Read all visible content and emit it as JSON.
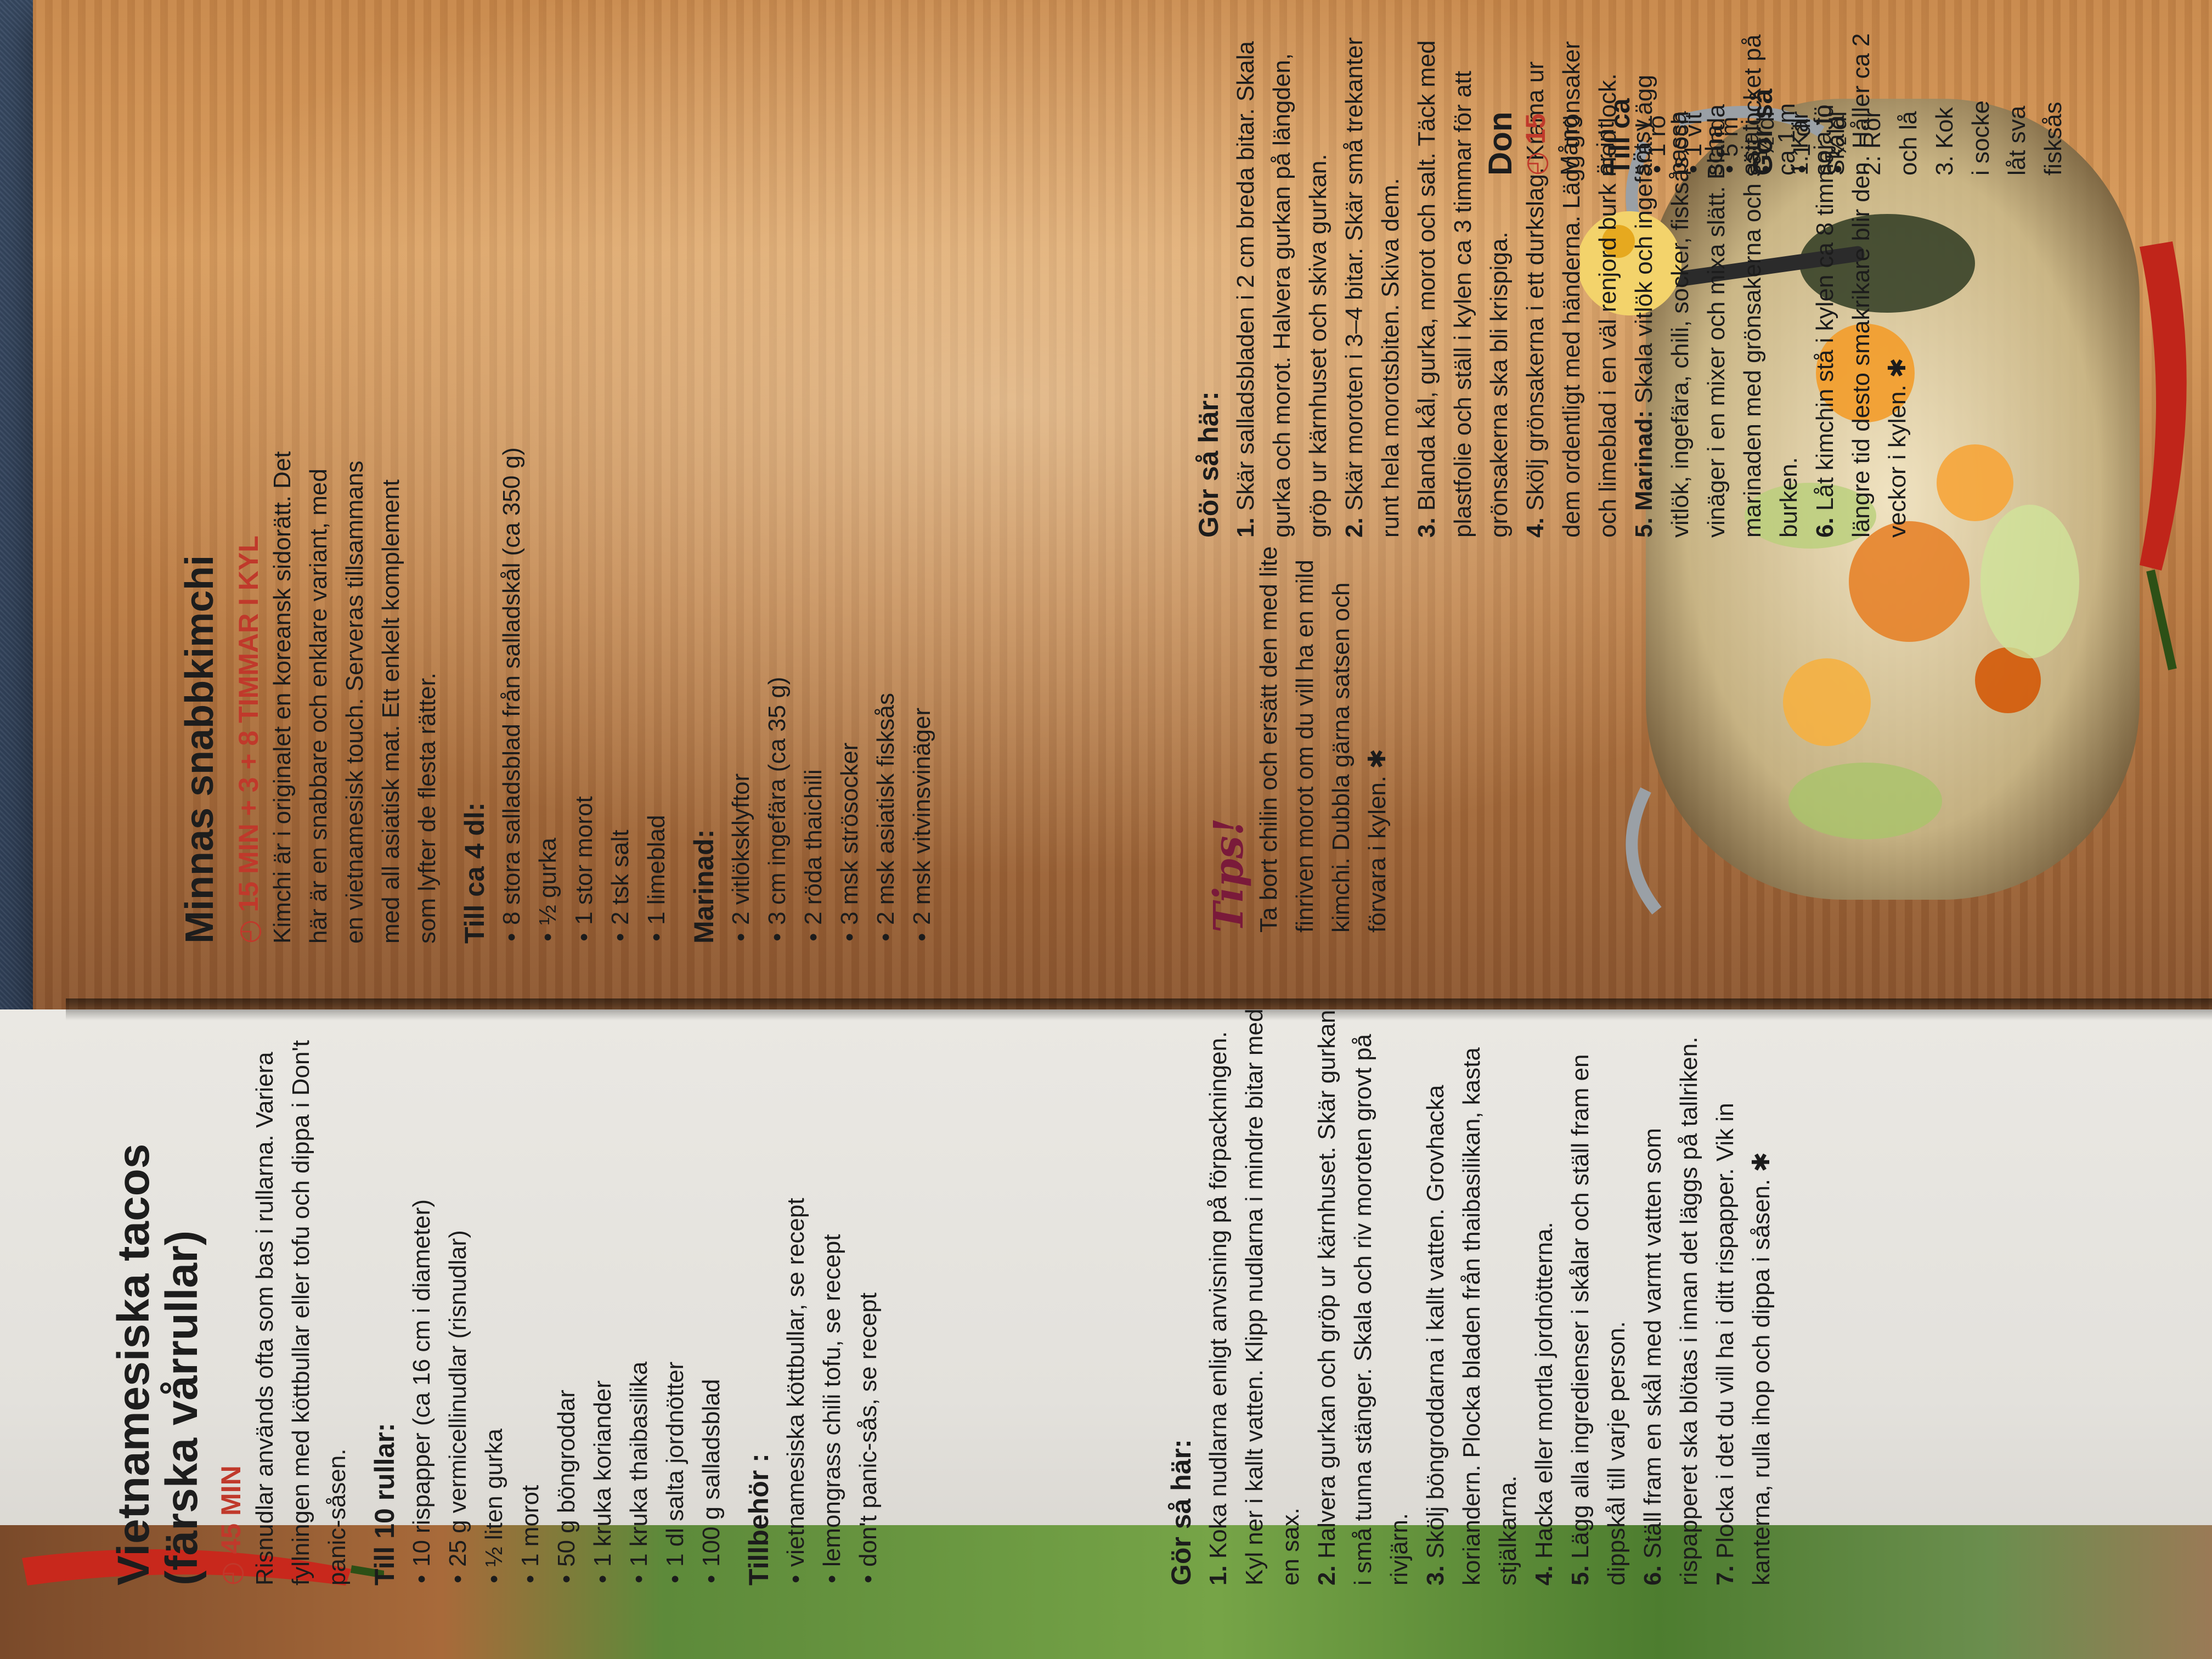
{
  "left_recipe": {
    "title_line1": "Vietnamesiska tacos",
    "title_line2": "(färska vårrullar)",
    "time": "45 MIN",
    "intro": "Risnudlar används ofta som bas i rullarna. Variera fyllningen med köttbullar eller tofu och dippa i Don't panic-såsen.",
    "ingredients_heading": "Till 10 rullar:",
    "ingredients": [
      "10 rispapper (ca 16 cm i diameter)",
      "25 g vermicellinudlar (risnudlar)",
      "½ liten gurka",
      "1 morot",
      "50 g böngroddar",
      "1 kruka koriander",
      "1 kruka thaibasilika",
      "1 dl salta jordnötter",
      "100 g salladsblad"
    ],
    "extras_heading": "Tillbehör :",
    "extras": [
      "vietnamesiska köttbullar, se recept",
      "lemongrass chili tofu, se recept",
      "don't panic-sås, se recept"
    ],
    "method_heading": "Gör så här:",
    "steps": [
      {
        "n": "1.",
        "t": "Koka nudlarna enligt anvisning på förpackningen. Kyl ner i kallt vatten. Klipp nudlarna i mindre bitar med en sax."
      },
      {
        "n": "2.",
        "t": "Halvera gurkan och gröp ur kärnhuset. Skär gurkan i små tunna stänger. Skala och riv moroten grovt på rivjärn."
      },
      {
        "n": "3.",
        "t": "Skölj böngroddarna i kallt vatten. Grovhacka koriandern. Plocka bladen från thaibasilikan, kasta stjälkarna."
      },
      {
        "n": "4.",
        "t": "Hacka eller mortla jordnötterna."
      },
      {
        "n": "5.",
        "t": "Lägg alla ingredienser i skålar och ställ fram en dippskål till varje person."
      },
      {
        "n": "6.",
        "t": "Ställ fram en skål med varmt vatten som rispapperet ska blötas i innan det läggs på tallriken."
      },
      {
        "n": "7.",
        "t": "Plocka i det du vill ha i ditt rispapper. Vik in kanterna, rulla ihop och dippa i såsen. ✱"
      }
    ]
  },
  "right_recipe": {
    "title": "Minnas snabbkimchi",
    "time": "15 MIN + 3 + 8 TIMMAR I KYL",
    "intro": "Kimchi är i originalet en koreansk sidorätt. Det här är en snabbare och enklare variant, med en vietnamesisk touch. Serveras tillsammans med all asiatisk mat. Ett enkelt komplement som lyfter de flesta rätter.",
    "ingredients_heading": "Till ca 4 dl:",
    "ingredients": [
      "8 stora salladsblad från salladskål (ca 350 g)",
      "½ gurka",
      "1 stor morot",
      "2 tsk salt",
      "1 limeblad"
    ],
    "marinade_heading": "Marinad:",
    "marinade": [
      "2 vitlöksklyftor",
      "3 cm ingefära (ca 35 g)",
      "2 röda thaichili",
      "3 msk strösocker",
      "2 msk asiatisk fisksås",
      "2 msk vitvinsvinäger"
    ],
    "tips_heading": "Tips!",
    "tips_text": "Ta bort chilin och ersätt den med lite finriven morot om du vill ha en mild kimchi. Dubbla gärna satsen och förvara i kylen. ✱",
    "method_heading": "Gör så här:",
    "steps": [
      {
        "n": "1.",
        "t": "Skär salladsbladen i 2 cm breda bitar. Skala gurka och morot. Halvera gurkan på längden, gröp ur kärnhuset och skiva gurkan."
      },
      {
        "n": "2.",
        "t": "Skär moroten i 3–4 bitar. Skär små trekanter runt hela morotsbiten. Skiva dem."
      },
      {
        "n": "3.",
        "t": "Blanda kål, gurka, morot och salt. Täck med plastfolie och ställ i kylen ca 3 timmar för att grönsakerna ska bli krispiga."
      },
      {
        "n": "4.",
        "t": "Skölj grönsakerna i ett durkslag. Krama ur dem ordentligt med händerna. Lägg grönsaker och limeblad i en väl renjord burk med lock."
      },
      {
        "n": "5. Marinad:",
        "t": "Skala vitlök och ingefära. Lägg vitlök, ingefära, chili, socker, fisksås och vinäger i en mixer och mixa slätt. Blanda marinaden med grönsakerna och sätt locket på burken."
      },
      {
        "n": "6.",
        "t": "Låt kimchin stå i kylen ca 8 timmar. Ju längre tid desto smakrikare blir den. Håller ca 2 veckor i kylen. ✱"
      }
    ]
  },
  "cut_column": {
    "title": "Don",
    "time": "15",
    "lines": [
      "Mång",
      "är int",
      "sötsy",
      "passa",
      "scha",
      "asiati",
      "ca 1 m",
      "soja fö"
    ],
    "heading2": "Till ca",
    "items": [
      "1 rö",
      "1 vit",
      "5 m",
      "½ dl",
      "1 dl",
      "½ dl"
    ],
    "heading3": "Gör så",
    "steps": [
      "1. Kär",
      "Skala",
      "2. Rör",
      "och lå",
      "3. Kok",
      "i socke",
      "låt sva",
      "fisksås"
    ]
  },
  "colors": {
    "accent_red": "#c0392b",
    "tips_purple": "#7a1a3a",
    "paper": "#e6e4df",
    "wood": "#c7874a"
  }
}
